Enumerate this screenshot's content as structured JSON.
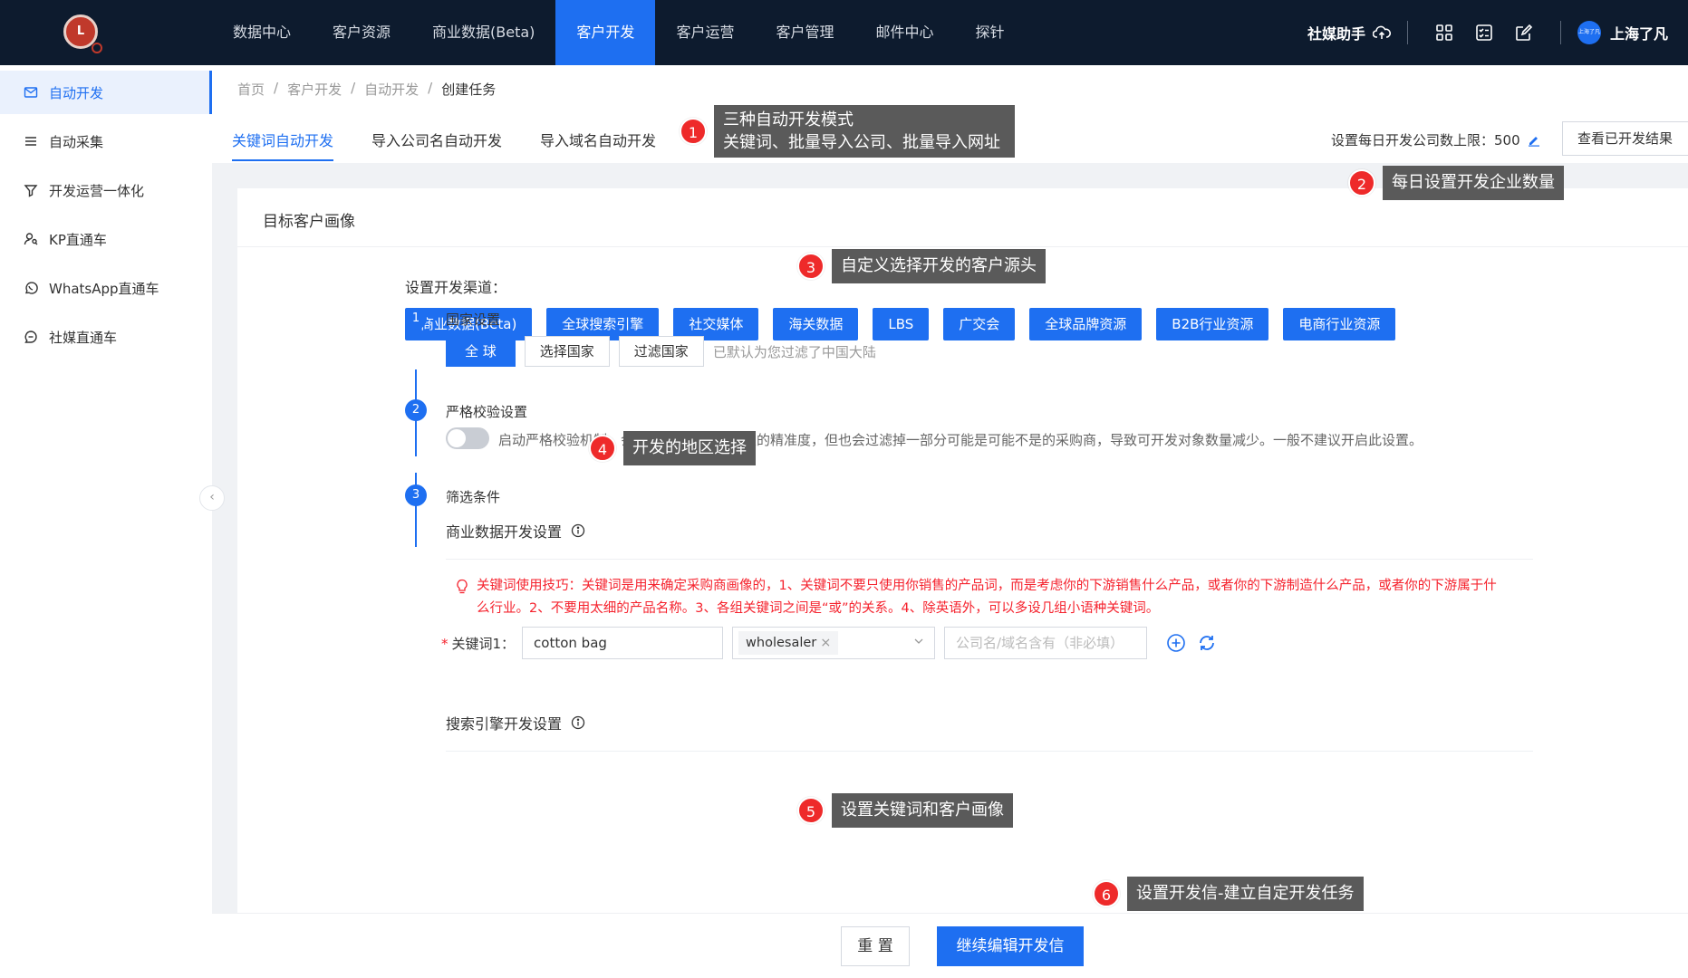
{
  "nav": {
    "items": [
      "数据中心",
      "客户资源",
      "商业数据(Beta)",
      "客户开发",
      "客户运营",
      "客户管理",
      "邮件中心",
      "探针"
    ],
    "active_index": 3,
    "social_helper": "社媒助手",
    "avatar_text": "上海了凡",
    "username": "上海了凡"
  },
  "sidebar": {
    "items": [
      {
        "label": "自动开发",
        "icon": "mail-icon"
      },
      {
        "label": "自动采集",
        "icon": "list-icon"
      },
      {
        "label": "开发运营一体化",
        "icon": "filter-icon"
      },
      {
        "label": "KP直通车",
        "icon": "user-search-icon"
      },
      {
        "label": "WhatsApp直通车",
        "icon": "whatsapp-icon"
      },
      {
        "label": "社媒直通车",
        "icon": "chat-icon"
      }
    ],
    "collapse_glyph": "‹"
  },
  "breadcrumb": [
    "首页",
    "客户开发",
    "自动开发",
    "创建任务"
  ],
  "tabs": [
    "关键词自动开发",
    "导入公司名自动开发",
    "导入域名自动开发"
  ],
  "header": {
    "limit_label": "设置每日开发公司数上限：500",
    "view_results": "查看已开发结果"
  },
  "card": {
    "title": "目标客户画像",
    "channel_label": "设置开发渠道：",
    "channels": [
      "商业数据(Beta)",
      "全球搜索引擎",
      "社交媒体",
      "海关数据",
      "LBS",
      "广交会",
      "全球品牌资源",
      "B2B行业资源",
      "电商行业资源"
    ],
    "steps": [
      {
        "num": "1",
        "title": "国家设置"
      },
      {
        "num": "2",
        "title": "严格校验设置"
      },
      {
        "num": "3",
        "title": "筛选条件"
      }
    ],
    "country": {
      "global": "全 球",
      "select": "选择国家",
      "filter": "过滤国家",
      "hint": "已默认为您过滤了中国大陆"
    },
    "strict_desc": "启动严格校验机制，会进一步提升自动开发的精准度，但也会过滤掉一部分可能是可能不是的采购商，导致可开发对象数量减少。一般不建议开启此设置。",
    "biz_title": "商业数据开发设置",
    "tip": "关键词使用技巧：关键词是用来确定采购商画像的，1、关键词不要只使用你销售的产品词，而是考虑你的下游销售什么产品，或者你的下游制造什么产品，或者你的下游属于什么行业。2、不要用太细的产品名称。3、各组关键词之间是“或”的关系。4、除英语外，可以多设几组小语种关键词。",
    "keyword": {
      "label": "关键词1：",
      "star": "*",
      "value": "cotton bag",
      "tag": "wholesaler",
      "tag_close": "×",
      "company_placeholder": "公司名/域名含有（非必填）"
    },
    "search_title": "搜索引擎开发设置"
  },
  "bottom": {
    "reset": "重 置",
    "continue": "继续编辑开发信"
  },
  "annotations": [
    {
      "num": "1",
      "text_line1": "三种自动开发模式",
      "text_line2": "关键词、批量导入公司、批量导入网址"
    },
    {
      "num": "2",
      "text": "每日设置开发企业数量"
    },
    {
      "num": "3",
      "text": "自定义选择开发的客户源头"
    },
    {
      "num": "4",
      "text": "开发的地区选择"
    },
    {
      "num": "5",
      "text": "设置关键词和客户画像"
    },
    {
      "num": "6",
      "text": "设置开发信-建立自定开发任务"
    }
  ],
  "colors": {
    "primary": "#1e6ff1",
    "topbar": "#0d1b2e",
    "annotation_badge": "#ee2a2a",
    "annotation_box": "#5a5a5a",
    "tip_red": "#f5222d"
  }
}
